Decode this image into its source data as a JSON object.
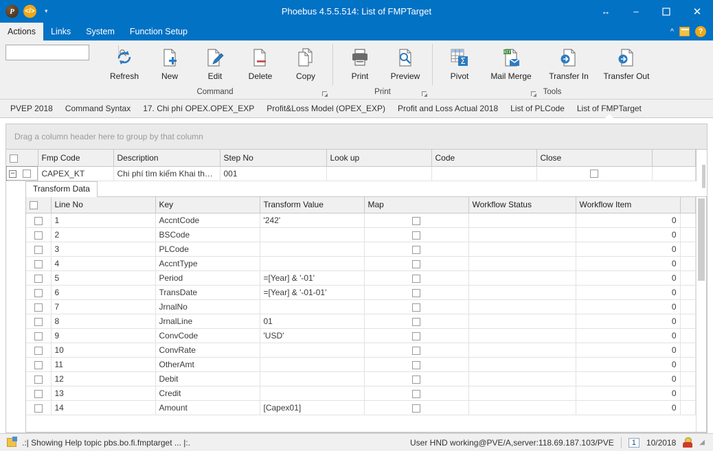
{
  "window": {
    "title": "Phoebus 4.5.5.514: List of FMPTarget",
    "quick_access": [
      "app-logo",
      "code-icon",
      "customize-caret"
    ],
    "controls": {
      "restore_width": "↔",
      "minimize": "–",
      "maximize": "❐",
      "close": "✕"
    }
  },
  "menubar": {
    "items": [
      {
        "label": "Actions",
        "active": true
      },
      {
        "label": "Links",
        "active": false
      },
      {
        "label": "System",
        "active": false
      },
      {
        "label": "Function Setup",
        "active": false
      }
    ],
    "right_icons": [
      "ribbon-collapse-icon",
      "book-icon",
      "help-icon"
    ],
    "help_glyph": "?"
  },
  "ribbon": {
    "search": {
      "value": "",
      "placeholder": ""
    },
    "groups": [
      {
        "label": "Command",
        "has_dialog_launcher": true,
        "buttons": [
          {
            "label": "Refresh",
            "icon": "refresh-icon"
          },
          {
            "label": "New",
            "icon": "new-document-icon"
          },
          {
            "label": "Edit",
            "icon": "edit-pencil-icon"
          },
          {
            "label": "Delete",
            "icon": "delete-document-icon"
          },
          {
            "label": "Copy",
            "icon": "copy-icon"
          }
        ]
      },
      {
        "label": "Print",
        "has_dialog_launcher": true,
        "buttons": [
          {
            "label": "Print",
            "icon": "printer-icon"
          },
          {
            "label": "Preview",
            "icon": "print-preview-icon"
          }
        ]
      },
      {
        "label": "Tools",
        "has_dialog_launcher": true,
        "buttons": [
          {
            "label": "Pivot",
            "icon": "pivot-table-icon"
          },
          {
            "label": "Mail Merge",
            "icon": "mail-merge-icon"
          },
          {
            "label": "Transfer In",
            "icon": "transfer-in-icon"
          },
          {
            "label": "Transfer Out",
            "icon": "transfer-out-icon"
          }
        ]
      }
    ]
  },
  "breadcrumbs": [
    {
      "label": "PVEP 2018",
      "active": false
    },
    {
      "label": "Command Syntax",
      "active": false
    },
    {
      "label": "17. Chi phí OPEX.OPEX_EXP",
      "active": false
    },
    {
      "label": "Profit&Loss Model (OPEX_EXP)",
      "active": false
    },
    {
      "label": "Profit and Loss Actual 2018",
      "active": false
    },
    {
      "label": "List of PLCode",
      "active": false
    },
    {
      "label": "List of FMPTarget",
      "active": true
    }
  ],
  "grid": {
    "group_hint": "Drag a column header here to group by that column",
    "master": {
      "columns": [
        "",
        "Fmp Code",
        "Description",
        "Step No",
        "Look up",
        "Code",
        "Close"
      ],
      "rows": [
        {
          "expanded": true,
          "expander_glyph": "−",
          "selected": false,
          "fmp_code": "CAPEX_KT",
          "description": "Chi phí tìm kiếm Khai thác dầu khí…",
          "step_no": "001",
          "look_up": "",
          "code": "",
          "close_checked": false
        }
      ]
    },
    "detail": {
      "tab_label": "Transform Data",
      "columns": [
        "",
        "Line No",
        "Key",
        "Transform Value",
        "Map",
        "Workflow Status",
        "Workflow Item",
        ""
      ],
      "rows": [
        {
          "line_no": "1",
          "key": "AccntCode",
          "transform_value": "'242'",
          "map": false,
          "workflow_status": "",
          "workflow_item": "0"
        },
        {
          "line_no": "2",
          "key": "BSCode",
          "transform_value": "",
          "map": false,
          "workflow_status": "",
          "workflow_item": "0"
        },
        {
          "line_no": "3",
          "key": "PLCode",
          "transform_value": "",
          "map": false,
          "workflow_status": "",
          "workflow_item": "0"
        },
        {
          "line_no": "4",
          "key": "AccntType",
          "transform_value": "",
          "map": false,
          "workflow_status": "",
          "workflow_item": "0"
        },
        {
          "line_no": "5",
          "key": "Period",
          "transform_value": "=[Year] & '-01'",
          "map": false,
          "workflow_status": "",
          "workflow_item": "0"
        },
        {
          "line_no": "6",
          "key": "TransDate",
          "transform_value": "=[Year] & '-01-01'",
          "map": false,
          "workflow_status": "",
          "workflow_item": "0"
        },
        {
          "line_no": "7",
          "key": "JrnalNo",
          "transform_value": "",
          "map": false,
          "workflow_status": "",
          "workflow_item": "0"
        },
        {
          "line_no": "8",
          "key": "JrnalLine",
          "transform_value": "01",
          "map": false,
          "workflow_status": "",
          "workflow_item": "0"
        },
        {
          "line_no": "9",
          "key": "ConvCode",
          "transform_value": "'USD'",
          "map": false,
          "workflow_status": "",
          "workflow_item": "0"
        },
        {
          "line_no": "10",
          "key": "ConvRate",
          "transform_value": "",
          "map": false,
          "workflow_status": "",
          "workflow_item": "0"
        },
        {
          "line_no": "11",
          "key": "OtherAmt",
          "transform_value": "",
          "map": false,
          "workflow_status": "",
          "workflow_item": "0"
        },
        {
          "line_no": "12",
          "key": "Debit",
          "transform_value": "",
          "map": false,
          "workflow_status": "",
          "workflow_item": "0"
        },
        {
          "line_no": "13",
          "key": "Credit",
          "transform_value": "",
          "map": false,
          "workflow_status": "",
          "workflow_item": "0"
        },
        {
          "line_no": "14",
          "key": "Amount",
          "transform_value": "[Capex01]",
          "map": false,
          "workflow_status": "",
          "workflow_item": "0"
        }
      ]
    }
  },
  "statusbar": {
    "message": ".:| Showing Help topic pbs.bo.fi.fmptarget ... |:.",
    "user_info": "User HND working@PVE/A,server:118.69.187.103/PVE",
    "page_number": "1",
    "period": "10/2018",
    "left_icon": "help-topic-icon",
    "user_icon": "user-avatar-icon"
  },
  "colors": {
    "titlebar": "#0272c5",
    "ribbon_bg": "#f0f0f0",
    "accent": "#2c7bc0",
    "grid_header": "#f0f0f0"
  }
}
